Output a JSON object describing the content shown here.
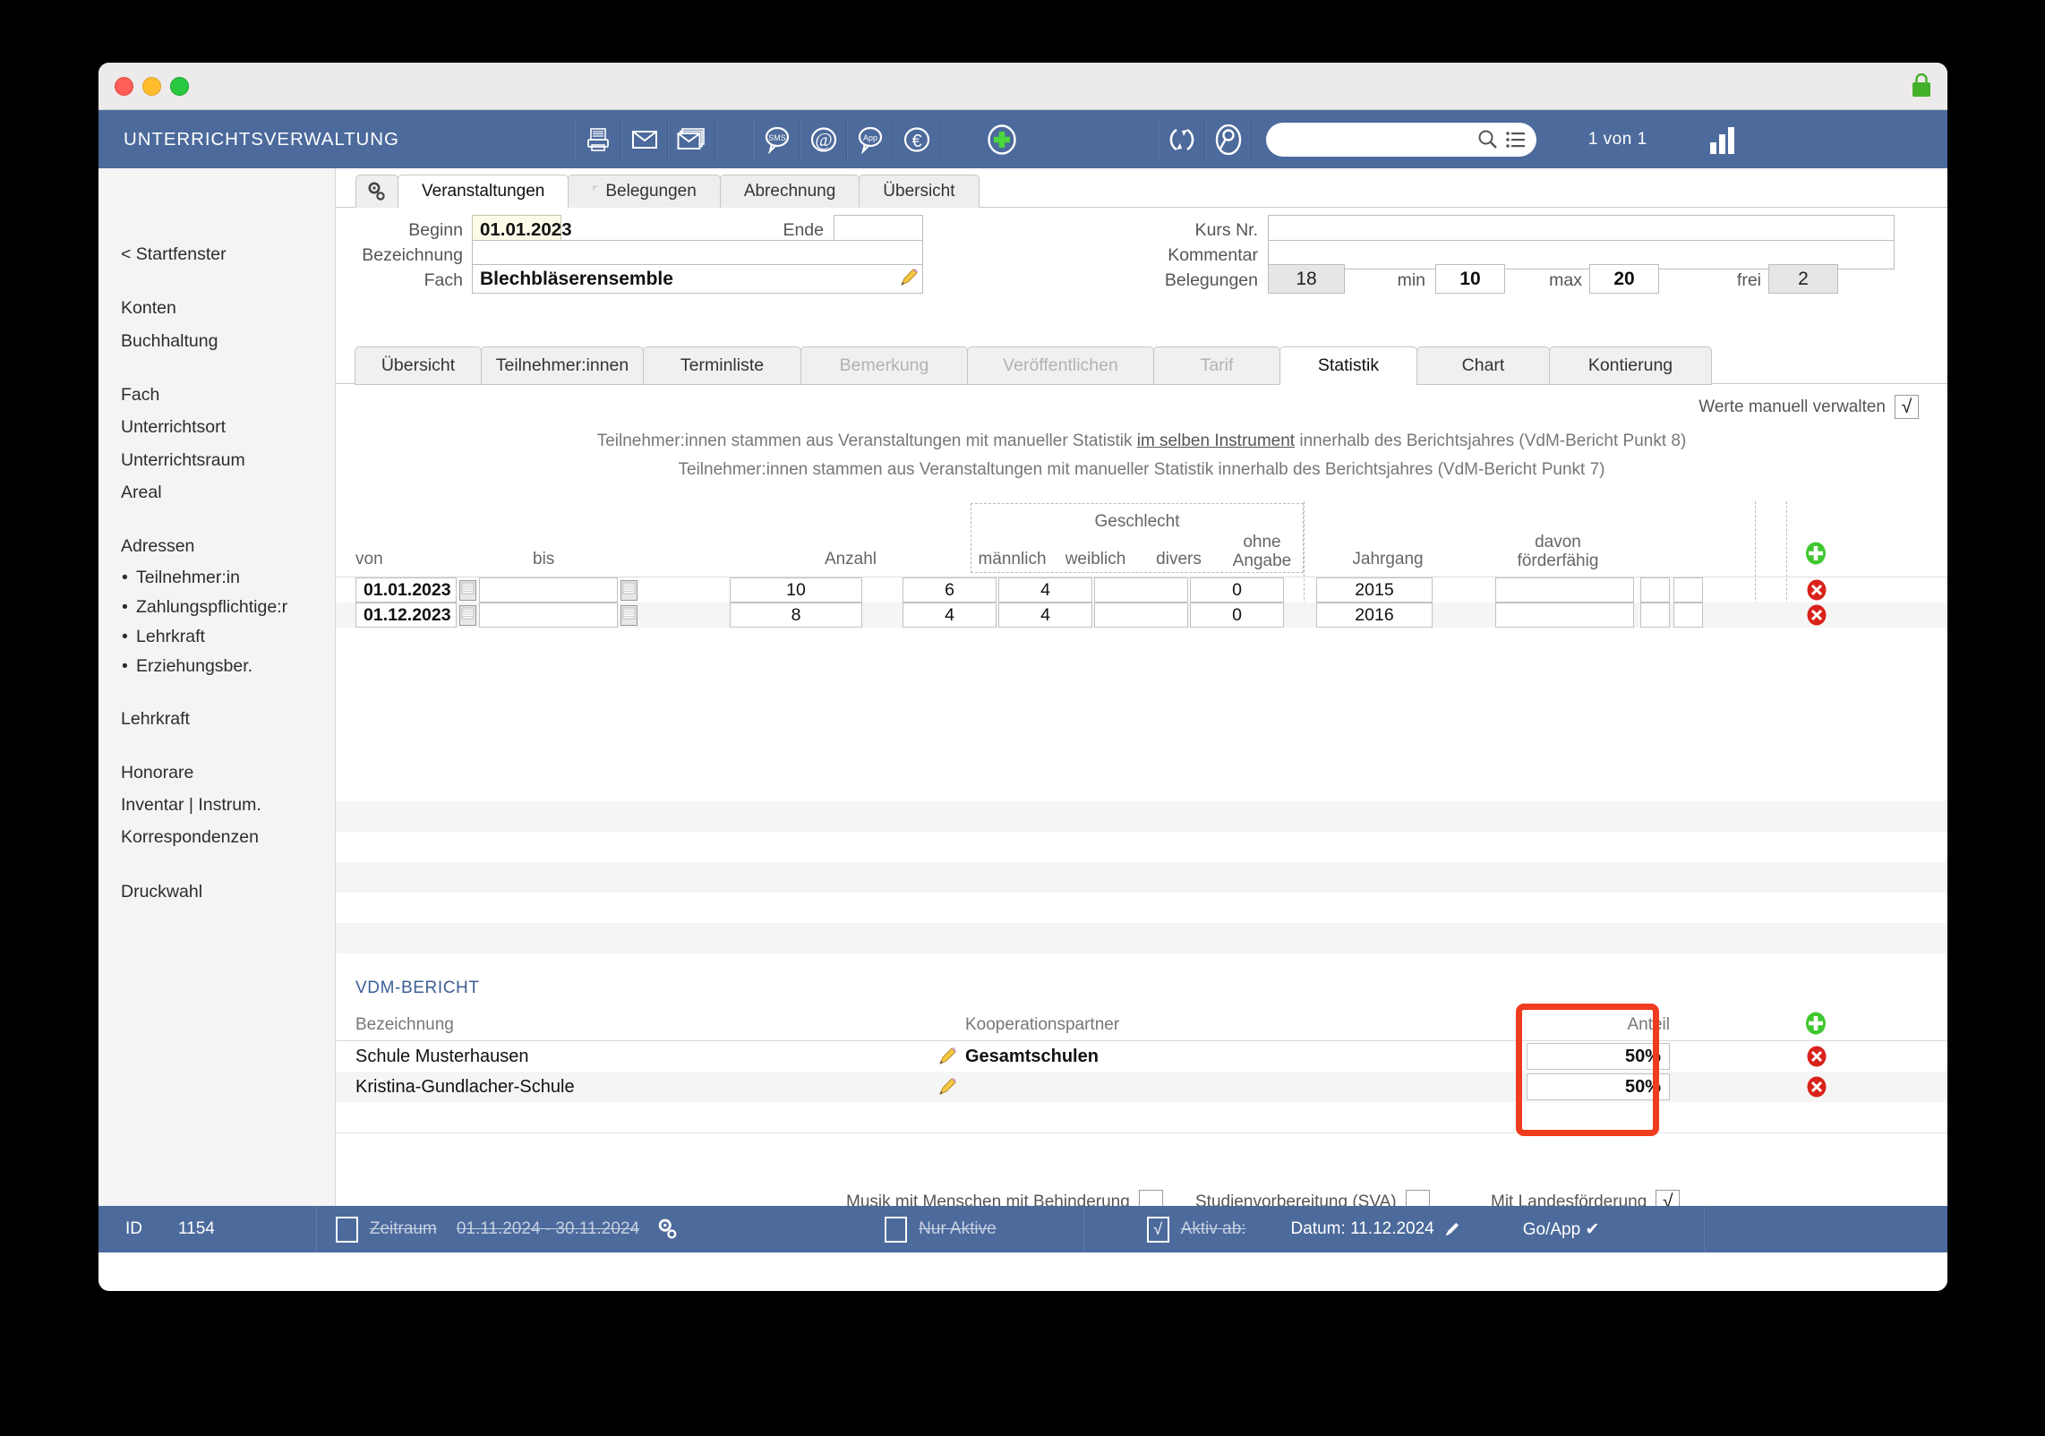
{
  "app": {
    "title": "UNTERRICHTSVERWALTUNG",
    "counter": "1 von 1",
    "toolbar_icons": [
      "printer-icon",
      "envelope-icon",
      "envelopes-icon",
      "sms-bubble-icon",
      "at-icon",
      "app-bubble-icon",
      "euro-icon",
      "plus-circle-icon",
      "refresh-icon",
      "search-person-icon"
    ],
    "search_value": ""
  },
  "sidebar": {
    "back": "< Startfenster",
    "group1": [
      "Konten",
      "Buchhaltung"
    ],
    "group2": [
      "Fach",
      "Unterrichtsort",
      "Unterrichtsraum",
      "Areal"
    ],
    "adressen_label": "Adressen",
    "adressen": [
      "Teilnehmer:in",
      "Zahlungspflichtige:r",
      "Lehrkraft",
      "Erziehungsber."
    ],
    "group3": [
      "Lehrkraft"
    ],
    "group4": [
      "Honorare",
      "Inventar | Instrum.",
      "Korrespondenzen"
    ],
    "group5": [
      "Druckwahl"
    ]
  },
  "top_tabs": [
    {
      "label": "Veranstaltungen",
      "active": true,
      "hook": false
    },
    {
      "label": "Belegungen",
      "active": false,
      "hook": true
    },
    {
      "label": "Abrechnung",
      "active": false,
      "hook": false
    },
    {
      "label": "Übersicht",
      "active": false,
      "hook": false
    }
  ],
  "form": {
    "beginn_label": "Beginn",
    "beginn_value": "01.01.2023",
    "ende_label": "Ende",
    "ende_value": "",
    "bezeichnung_label": "Bezeichnung",
    "bezeichnung_value": "",
    "fach_label": "Fach",
    "fach_value": "Blechbläserensemble",
    "kursnr_label": "Kurs Nr.",
    "kursnr_value": "",
    "kommentar_label": "Kommentar",
    "kommentar_value": "",
    "belegungen_label": "Belegungen",
    "belegungen_value": "18",
    "min_label": "min",
    "min_value": "10",
    "max_label": "max",
    "max_value": "20",
    "frei_label": "frei",
    "frei_value": "2"
  },
  "sub_tabs": [
    {
      "label": "Übersicht",
      "state": "normal"
    },
    {
      "label": "Teilnehmer:innen",
      "state": "normal"
    },
    {
      "label": "Terminliste",
      "state": "normal"
    },
    {
      "label": "Bemerkung",
      "state": "disabled"
    },
    {
      "label": "Veröffentlichen",
      "state": "disabled"
    },
    {
      "label": "Tarif",
      "state": "disabled"
    },
    {
      "label": "Statistik",
      "state": "active"
    },
    {
      "label": "Chart",
      "state": "normal"
    },
    {
      "label": "Kontierung",
      "state": "normal"
    }
  ],
  "statistik": {
    "manual_label": "Werte manuell verwalten",
    "manual_checked": "√",
    "note1_a": "Teilnehmer:innen stammen aus Veranstaltungen mit manueller Statistik ",
    "note1_u": "im selben Instrument",
    "note1_b": " innerhalb des Berichtsjahres (VdM-Bericht Punkt 8)",
    "note2": "Teilnehmer:innen stammen aus Veranstaltungen mit manueller Statistik innerhalb des Berichtsjahres (VdM-Bericht Punkt 7)",
    "group_header": "Geschlecht",
    "columns": {
      "von": "von",
      "bis": "bis",
      "anzahl": "Anzahl",
      "maennlich": "männlich",
      "weiblich": "weiblich",
      "divers": "divers",
      "ohne_angabe_1": "ohne",
      "ohne_angabe_2": "Angabe",
      "jahrgang": "Jahrgang",
      "davon_1": "davon",
      "davon_2": "förderfähig"
    },
    "rows": [
      {
        "von": "01.01.2023",
        "bis": "",
        "anzahl": "10",
        "maennlich": "6",
        "weiblich": "4",
        "divers": "",
        "ohne_angabe": "0",
        "jahrgang": "2015",
        "davon": ""
      },
      {
        "von": "01.12.2023",
        "bis": "",
        "anzahl": "8",
        "maennlich": "4",
        "weiblich": "4",
        "divers": "",
        "ohne_angabe": "0",
        "jahrgang": "2016",
        "davon": ""
      }
    ]
  },
  "vdm": {
    "title": "VDM-BERICHT",
    "col_bezeichnung": "Bezeichnung",
    "col_partner": "Kooperationspartner",
    "col_anteil": "Anteil",
    "rows": [
      {
        "bezeichnung": "Schule Musterhausen",
        "partner": "Gesamtschulen",
        "anteil": "50%"
      },
      {
        "bezeichnung": "Kristina-Gundlacher-Schule",
        "partner": "",
        "anteil": "50%"
      }
    ]
  },
  "bottom_checks": [
    {
      "label": "Musik mit Menschen mit Behinderung",
      "checked": ""
    },
    {
      "label": "Studienvorbereitung (SVA)",
      "checked": ""
    },
    {
      "label": "Mit Landesförderung",
      "checked": "√"
    }
  ],
  "statusbar": {
    "id_label": "ID",
    "id_value": "1154",
    "zeitraum_label": "Zeitraum",
    "zeitraum_value": "01.11.2024 - 30.11.2024",
    "zeitraum_checked": "",
    "nur_aktive_label": "Nur Aktive",
    "nur_aktive_checked": "",
    "aktiv_ab_label": "Aktiv ab:",
    "aktiv_ab_checked": "√",
    "datum_label": "Datum: 11.12.2024",
    "goapp_label": "Go/App ✔"
  },
  "colors": {
    "accent_blue": "#4c6a9c",
    "status_green": "#5fdb3a",
    "status_yellow": "#f7f047",
    "status_red": "#e82e1e",
    "status_grey": "#8e8e8e",
    "highlight_red": "#f03c1e",
    "link_blue": "#3c5f96"
  }
}
